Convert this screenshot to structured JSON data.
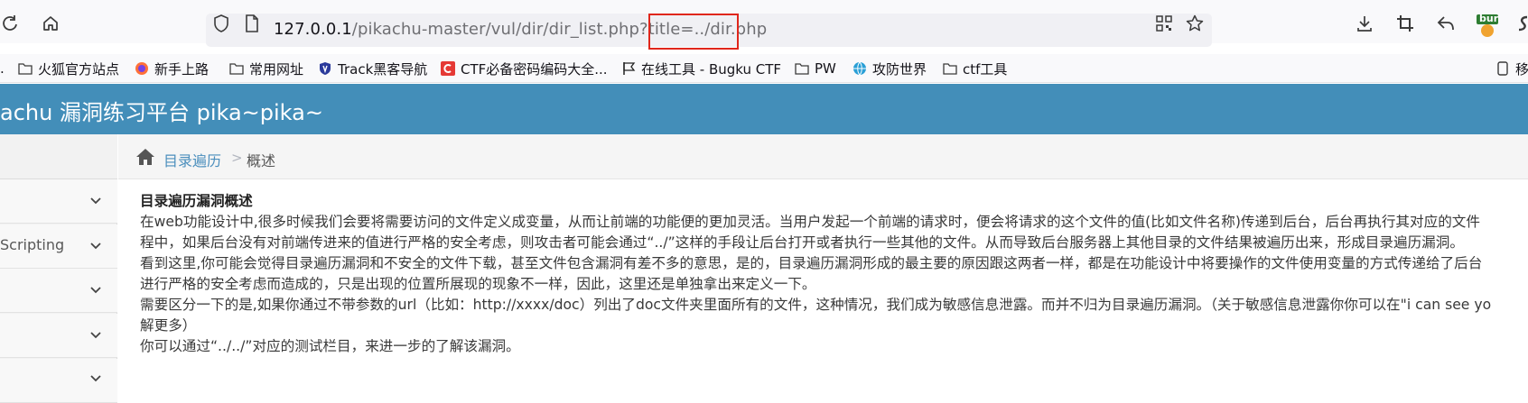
{
  "browser": {
    "url_host": "127.0.0.1",
    "url_path": "/pikachu-master/vul/dir/dir_list.php?title=",
    "url_highlighted": "../dir.php",
    "extension_badge": "bur"
  },
  "bookmarks": [
    {
      "label": "火狐官方站点",
      "icon": "folder-icon"
    },
    {
      "label": "新手上路",
      "icon": "firefox-icon"
    },
    {
      "label": "常用网址",
      "icon": "folder-icon"
    },
    {
      "label": "Track黑客导航",
      "icon": "track-shield-icon"
    },
    {
      "label": "CTF必备密码编码大全...",
      "icon": "ctf-c-icon"
    },
    {
      "label": "在线工具 - Bugku CTF",
      "icon": "flag-icon"
    },
    {
      "label": "PW",
      "icon": "folder-icon"
    },
    {
      "label": "攻防世界",
      "icon": "globe-icon"
    },
    {
      "label": "ctf工具",
      "icon": "folder-icon"
    }
  ],
  "bookmarks_overflow": "移",
  "header": {
    "title": "achu 漏洞练习平台 pika~pika~"
  },
  "sidebar": {
    "items": [
      {
        "label": ""
      },
      {
        "label": "Scripting"
      },
      {
        "label": ""
      },
      {
        "label": ""
      },
      {
        "label": ""
      }
    ]
  },
  "breadcrumb": {
    "link": "目录遍历",
    "separator": ">",
    "current": "概述"
  },
  "content": {
    "heading": "目录遍历漏洞概述",
    "lines": [
      "在web功能设计中,很多时候我们会要将需要访问的文件定义成变量，从而让前端的功能便的更加灵活。当用户发起一个前端的请求时，便会将请求的这个文件的值(比如文件名称)传递到后台，后台再执行其对应的文件",
      "程中，如果后台没有对前端传进来的值进行严格的安全考虑，则攻击者可能会通过“../”这样的手段让后台打开或者执行一些其他的文件。从而导致后台服务器上其他目录的文件结果被遍历出来，形成目录遍历漏洞。",
      "看到这里,你可能会觉得目录遍历漏洞和不安全的文件下载，甚至文件包含漏洞有差不多的意思，是的，目录遍历漏洞形成的最主要的原因跟这两者一样，都是在功能设计中将要操作的文件使用变量的方式传递给了后台",
      "进行严格的安全考虑而造成的，只是出现的位置所展现的现象不一样，因此，这里还是单独拿出来定义一下。",
      "需要区分一下的是,如果你通过不带参数的url（比如：http://xxxx/doc）列出了doc文件夹里面所有的文件，这种情况，我们成为敏感信息泄露。而并不归为目录遍历漏洞。（关于敏感信息泄露你你可以在\"i can see yo",
      "解更多）",
      "你可以通过“../../”对应的测试栏目，来进一步的了解该漏洞。"
    ]
  },
  "colors": {
    "header_bg": "#438eb9",
    "link": "#4c8fbd",
    "highlight_box": "#e0261b"
  }
}
